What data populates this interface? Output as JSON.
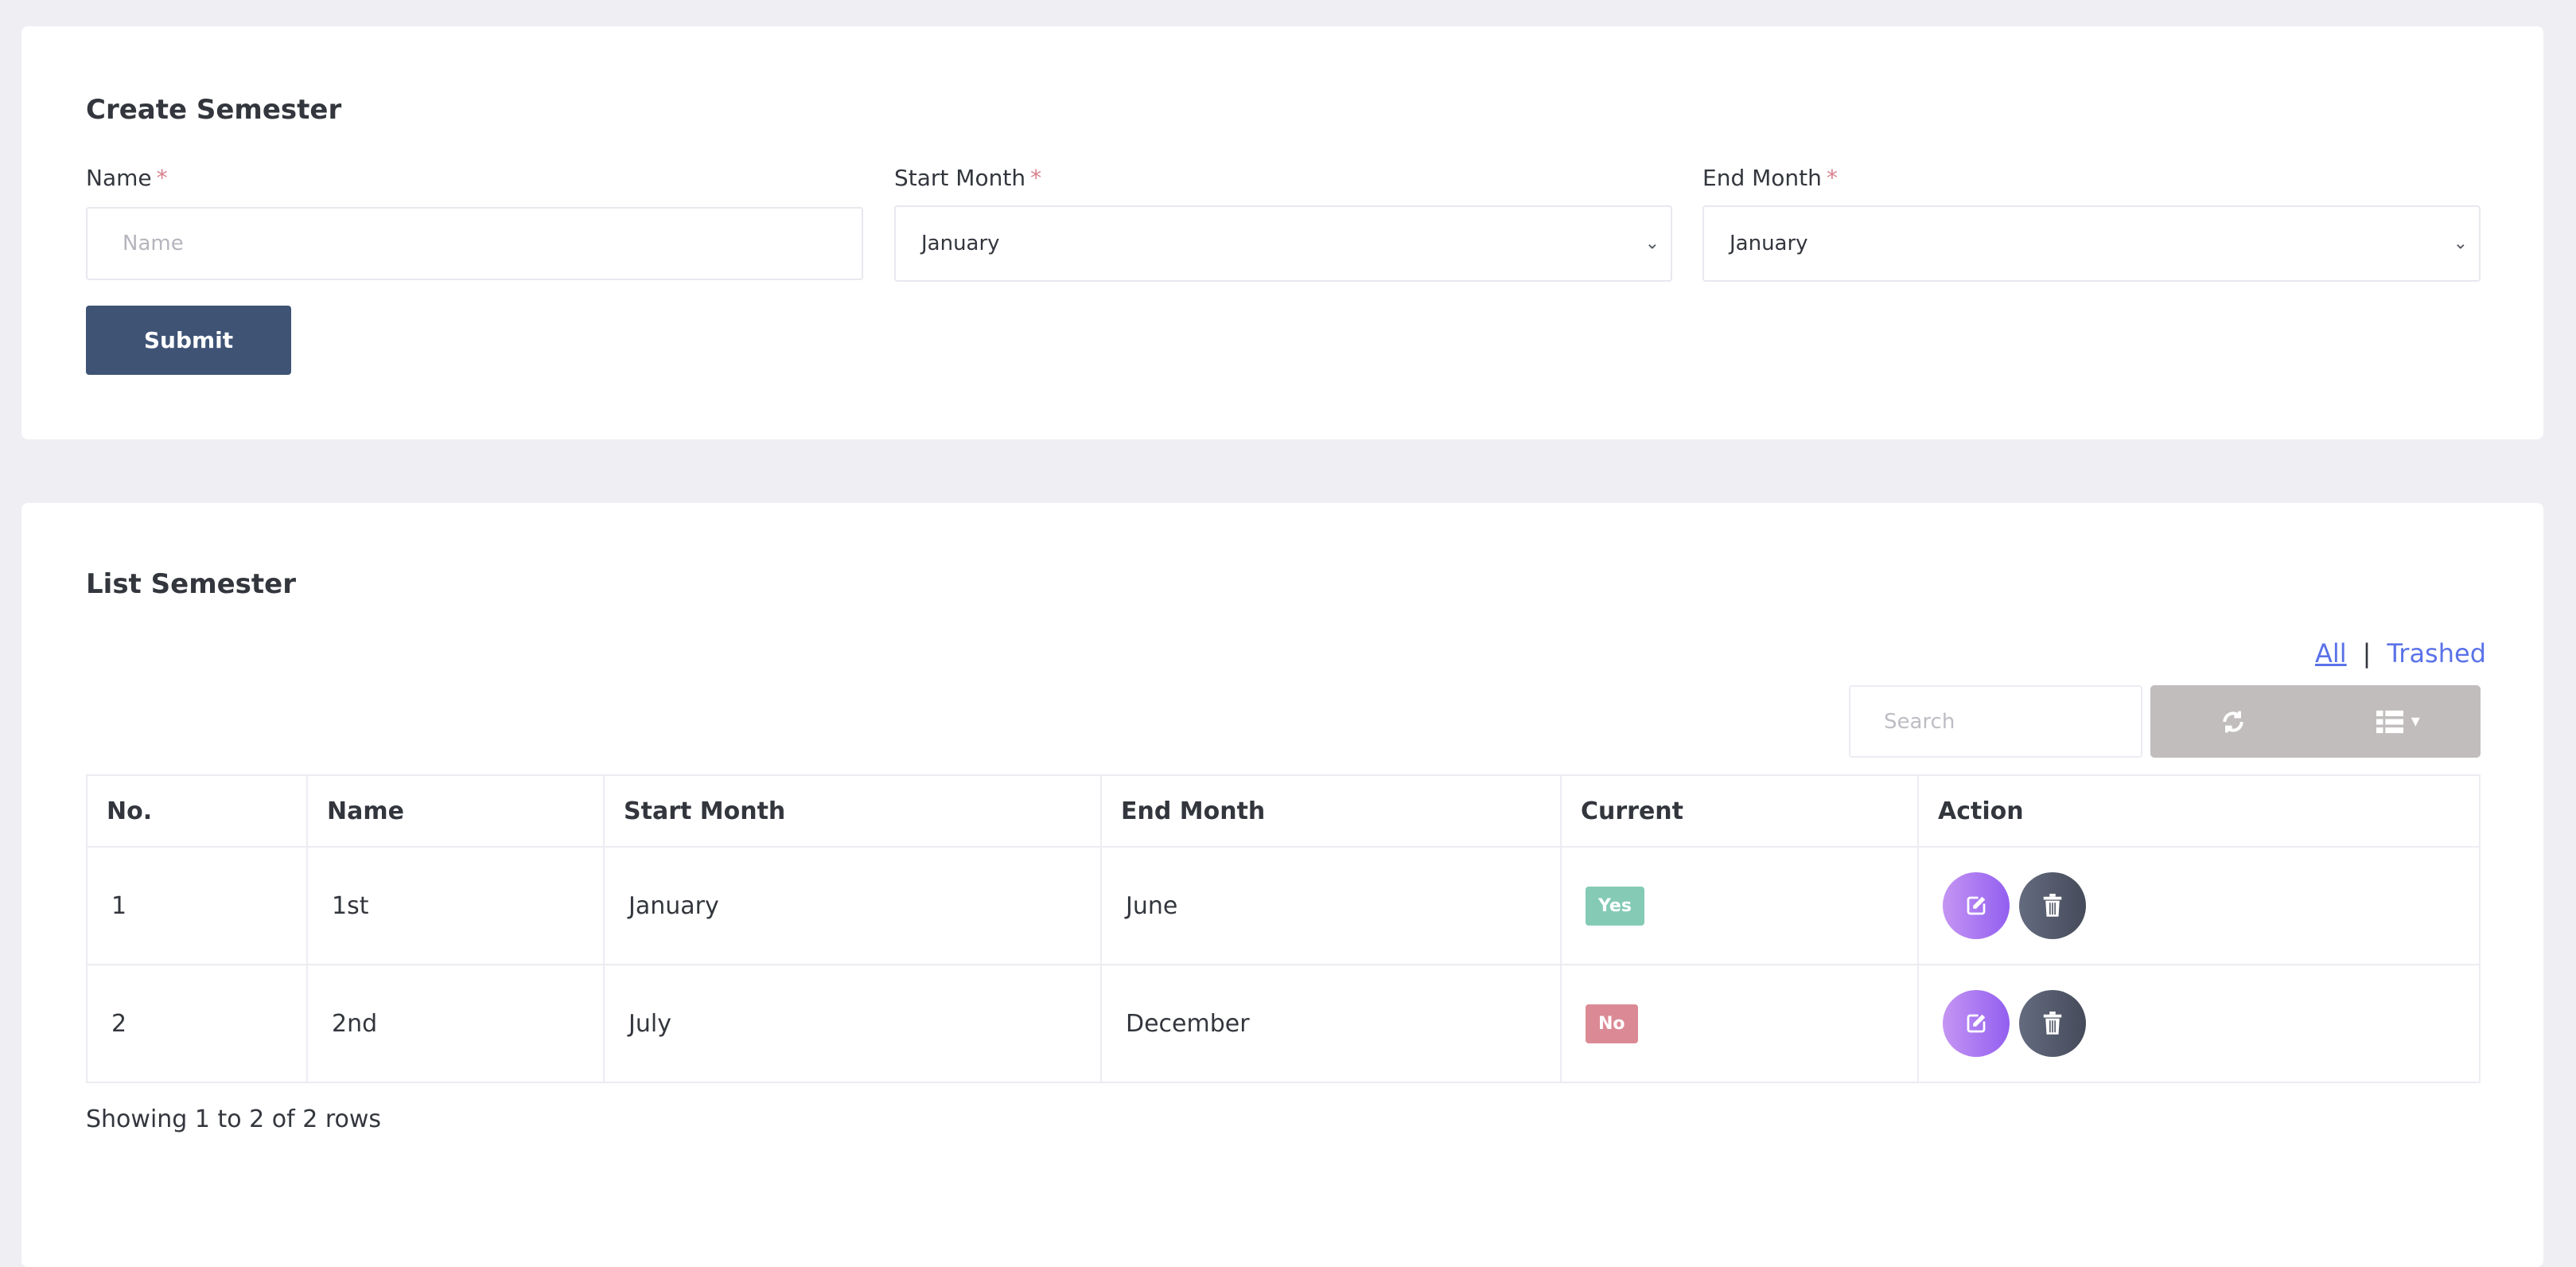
{
  "create_form": {
    "title": "Create Semester",
    "fields": {
      "name": {
        "label": "Name",
        "required_mark": "*",
        "value": "",
        "placeholder": "Name"
      },
      "start_month": {
        "label": "Start Month",
        "required_mark": "*",
        "selected": "January"
      },
      "end_month": {
        "label": "End Month",
        "required_mark": "*",
        "selected": "January"
      }
    },
    "submit_label": "Submit",
    "submit_color": "#3f5475"
  },
  "list": {
    "title": "List Semester",
    "filters": {
      "all": "All",
      "separator": "|",
      "trashed": "Trashed",
      "active": "All"
    },
    "search_placeholder": "Search",
    "toolbar": {
      "refresh_icon": "refresh-icon",
      "columns_icon": "list-icon",
      "columns_caret": "▾"
    },
    "columns": [
      "No.",
      "Name",
      "Start Month",
      "End Month",
      "Current",
      "Action"
    ],
    "rows": [
      {
        "no": "1",
        "name": "1st",
        "start": "January",
        "end": "June",
        "current": "Yes",
        "current_color": "#84cab5"
      },
      {
        "no": "2",
        "name": "2nd",
        "start": "July",
        "end": "December",
        "current": "No",
        "current_color": "#db8a95"
      }
    ],
    "footer": "Showing 1 to 2 of 2 rows"
  }
}
